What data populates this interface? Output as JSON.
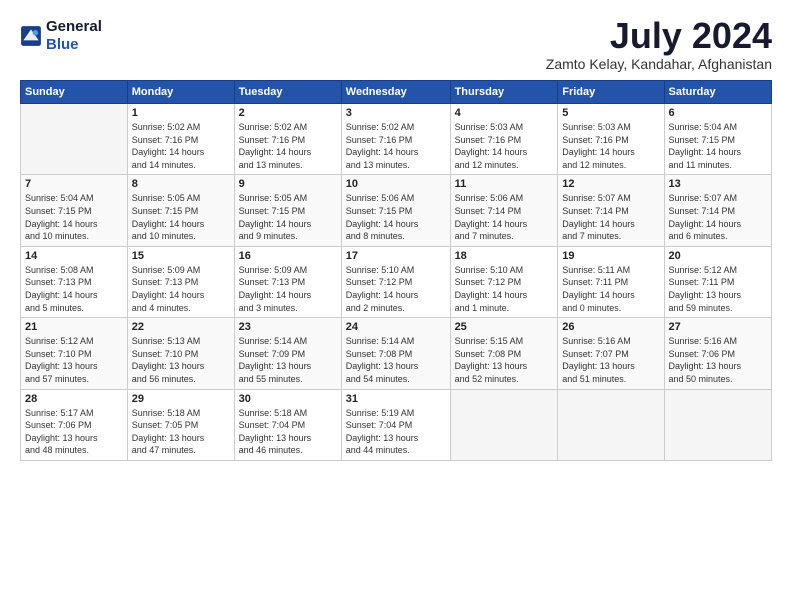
{
  "logo": {
    "general": "General",
    "blue": "Blue"
  },
  "header": {
    "month": "July 2024",
    "location": "Zamto Kelay, Kandahar, Afghanistan"
  },
  "weekdays": [
    "Sunday",
    "Monday",
    "Tuesday",
    "Wednesday",
    "Thursday",
    "Friday",
    "Saturday"
  ],
  "weeks": [
    [
      {
        "day": "",
        "sunrise": "",
        "sunset": "",
        "daylight": ""
      },
      {
        "day": "1",
        "sunrise": "Sunrise: 5:02 AM",
        "sunset": "Sunset: 7:16 PM",
        "daylight": "Daylight: 14 hours and 14 minutes."
      },
      {
        "day": "2",
        "sunrise": "Sunrise: 5:02 AM",
        "sunset": "Sunset: 7:16 PM",
        "daylight": "Daylight: 14 hours and 13 minutes."
      },
      {
        "day": "3",
        "sunrise": "Sunrise: 5:02 AM",
        "sunset": "Sunset: 7:16 PM",
        "daylight": "Daylight: 14 hours and 13 minutes."
      },
      {
        "day": "4",
        "sunrise": "Sunrise: 5:03 AM",
        "sunset": "Sunset: 7:16 PM",
        "daylight": "Daylight: 14 hours and 12 minutes."
      },
      {
        "day": "5",
        "sunrise": "Sunrise: 5:03 AM",
        "sunset": "Sunset: 7:16 PM",
        "daylight": "Daylight: 14 hours and 12 minutes."
      },
      {
        "day": "6",
        "sunrise": "Sunrise: 5:04 AM",
        "sunset": "Sunset: 7:15 PM",
        "daylight": "Daylight: 14 hours and 11 minutes."
      }
    ],
    [
      {
        "day": "7",
        "sunrise": "Sunrise: 5:04 AM",
        "sunset": "Sunset: 7:15 PM",
        "daylight": "Daylight: 14 hours and 10 minutes."
      },
      {
        "day": "8",
        "sunrise": "Sunrise: 5:05 AM",
        "sunset": "Sunset: 7:15 PM",
        "daylight": "Daylight: 14 hours and 10 minutes."
      },
      {
        "day": "9",
        "sunrise": "Sunrise: 5:05 AM",
        "sunset": "Sunset: 7:15 PM",
        "daylight": "Daylight: 14 hours and 9 minutes."
      },
      {
        "day": "10",
        "sunrise": "Sunrise: 5:06 AM",
        "sunset": "Sunset: 7:15 PM",
        "daylight": "Daylight: 14 hours and 8 minutes."
      },
      {
        "day": "11",
        "sunrise": "Sunrise: 5:06 AM",
        "sunset": "Sunset: 7:14 PM",
        "daylight": "Daylight: 14 hours and 7 minutes."
      },
      {
        "day": "12",
        "sunrise": "Sunrise: 5:07 AM",
        "sunset": "Sunset: 7:14 PM",
        "daylight": "Daylight: 14 hours and 7 minutes."
      },
      {
        "day": "13",
        "sunrise": "Sunrise: 5:07 AM",
        "sunset": "Sunset: 7:14 PM",
        "daylight": "Daylight: 14 hours and 6 minutes."
      }
    ],
    [
      {
        "day": "14",
        "sunrise": "Sunrise: 5:08 AM",
        "sunset": "Sunset: 7:13 PM",
        "daylight": "Daylight: 14 hours and 5 minutes."
      },
      {
        "day": "15",
        "sunrise": "Sunrise: 5:09 AM",
        "sunset": "Sunset: 7:13 PM",
        "daylight": "Daylight: 14 hours and 4 minutes."
      },
      {
        "day": "16",
        "sunrise": "Sunrise: 5:09 AM",
        "sunset": "Sunset: 7:13 PM",
        "daylight": "Daylight: 14 hours and 3 minutes."
      },
      {
        "day": "17",
        "sunrise": "Sunrise: 5:10 AM",
        "sunset": "Sunset: 7:12 PM",
        "daylight": "Daylight: 14 hours and 2 minutes."
      },
      {
        "day": "18",
        "sunrise": "Sunrise: 5:10 AM",
        "sunset": "Sunset: 7:12 PM",
        "daylight": "Daylight: 14 hours and 1 minute."
      },
      {
        "day": "19",
        "sunrise": "Sunrise: 5:11 AM",
        "sunset": "Sunset: 7:11 PM",
        "daylight": "Daylight: 14 hours and 0 minutes."
      },
      {
        "day": "20",
        "sunrise": "Sunrise: 5:12 AM",
        "sunset": "Sunset: 7:11 PM",
        "daylight": "Daylight: 13 hours and 59 minutes."
      }
    ],
    [
      {
        "day": "21",
        "sunrise": "Sunrise: 5:12 AM",
        "sunset": "Sunset: 7:10 PM",
        "daylight": "Daylight: 13 hours and 57 minutes."
      },
      {
        "day": "22",
        "sunrise": "Sunrise: 5:13 AM",
        "sunset": "Sunset: 7:10 PM",
        "daylight": "Daylight: 13 hours and 56 minutes."
      },
      {
        "day": "23",
        "sunrise": "Sunrise: 5:14 AM",
        "sunset": "Sunset: 7:09 PM",
        "daylight": "Daylight: 13 hours and 55 minutes."
      },
      {
        "day": "24",
        "sunrise": "Sunrise: 5:14 AM",
        "sunset": "Sunset: 7:08 PM",
        "daylight": "Daylight: 13 hours and 54 minutes."
      },
      {
        "day": "25",
        "sunrise": "Sunrise: 5:15 AM",
        "sunset": "Sunset: 7:08 PM",
        "daylight": "Daylight: 13 hours and 52 minutes."
      },
      {
        "day": "26",
        "sunrise": "Sunrise: 5:16 AM",
        "sunset": "Sunset: 7:07 PM",
        "daylight": "Daylight: 13 hours and 51 minutes."
      },
      {
        "day": "27",
        "sunrise": "Sunrise: 5:16 AM",
        "sunset": "Sunset: 7:06 PM",
        "daylight": "Daylight: 13 hours and 50 minutes."
      }
    ],
    [
      {
        "day": "28",
        "sunrise": "Sunrise: 5:17 AM",
        "sunset": "Sunset: 7:06 PM",
        "daylight": "Daylight: 13 hours and 48 minutes."
      },
      {
        "day": "29",
        "sunrise": "Sunrise: 5:18 AM",
        "sunset": "Sunset: 7:05 PM",
        "daylight": "Daylight: 13 hours and 47 minutes."
      },
      {
        "day": "30",
        "sunrise": "Sunrise: 5:18 AM",
        "sunset": "Sunset: 7:04 PM",
        "daylight": "Daylight: 13 hours and 46 minutes."
      },
      {
        "day": "31",
        "sunrise": "Sunrise: 5:19 AM",
        "sunset": "Sunset: 7:04 PM",
        "daylight": "Daylight: 13 hours and 44 minutes."
      },
      {
        "day": "",
        "sunrise": "",
        "sunset": "",
        "daylight": ""
      },
      {
        "day": "",
        "sunrise": "",
        "sunset": "",
        "daylight": ""
      },
      {
        "day": "",
        "sunrise": "",
        "sunset": "",
        "daylight": ""
      }
    ]
  ]
}
